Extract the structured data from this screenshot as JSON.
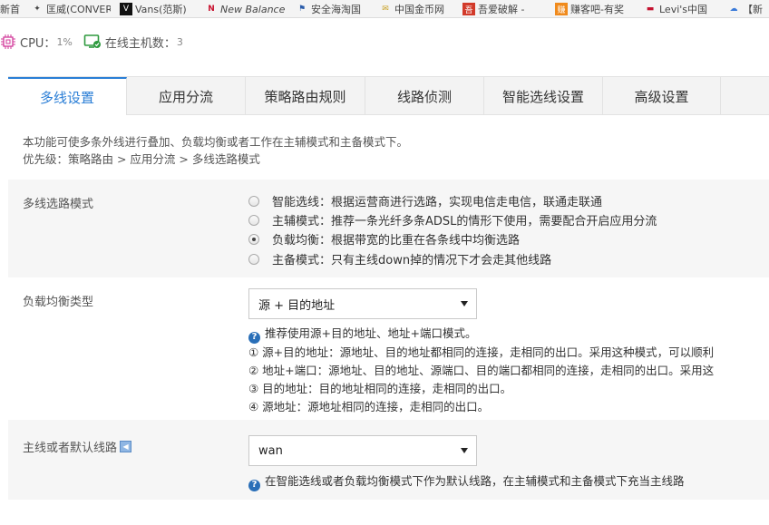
{
  "bookmarks": [
    {
      "label": "新首",
      "icon": "blank-icon",
      "color": "#888888"
    },
    {
      "label": "匡威(CONVER",
      "icon": "converse-star-icon",
      "color": "#333333"
    },
    {
      "label": "Vans(范斯)",
      "icon": "vans-v-icon",
      "color": "#111111"
    },
    {
      "label": "New Balance",
      "icon": "nb-logo-icon",
      "color": "#c8102e"
    },
    {
      "label": "安全海淘国",
      "icon": "flag-icon",
      "color": "#2a5caa"
    },
    {
      "label": "中国金币网",
      "icon": "envelope-icon",
      "color": "#c9a227"
    },
    {
      "label": "吾爱破解 -",
      "icon": "52pojie-icon",
      "color": "#d23a2a"
    },
    {
      "label": "赚客吧-有奖",
      "icon": "zhuanke-icon",
      "color": "#f08a1c"
    },
    {
      "label": "Levi's中国",
      "icon": "levis-icon",
      "color": "#c41230"
    },
    {
      "label": "【新",
      "icon": "cloud-icon",
      "color": "#3a7ad9"
    }
  ],
  "status": {
    "cpu_label": "CPU：",
    "cpu_value": "1%",
    "hosts_label": "在线主机数：",
    "hosts_value": "3"
  },
  "tabs": [
    {
      "label": "多线设置",
      "active": true
    },
    {
      "label": "应用分流",
      "active": false
    },
    {
      "label": "策略路由规则",
      "active": false
    },
    {
      "label": "线路侦测",
      "active": false
    },
    {
      "label": "智能选线设置",
      "active": false
    },
    {
      "label": "高级设置",
      "active": false
    }
  ],
  "intro": {
    "line1": "本功能可使多条外线进行叠加、负载均衡或者工作在主辅模式和主备模式下。",
    "line2": "优先级：策略路由 > 应用分流 > 多线选路模式"
  },
  "mode_section": {
    "label": "多线选路模式",
    "options": [
      {
        "text": "智能选线：根据运营商进行选路，实现电信走电信，联通走联通",
        "checked": false
      },
      {
        "text": "主辅模式：推荐一条光纤多条ADSL的情形下使用，需要配合开启应用分流",
        "checked": false
      },
      {
        "text": "负载均衡：根据带宽的比重在各条线中均衡选路",
        "checked": true
      },
      {
        "text": "主备模式：只有主线down掉的情况下才会走其他线路",
        "checked": false
      }
    ]
  },
  "lb_section": {
    "label": "负载均衡类型",
    "selected": "源 + 目的地址",
    "help_title": "推荐使用源+目的地址、地址+端口模式。",
    "help_lines": [
      "① 源+目的地址：源地址、目的地址都相同的连接，走相同的出口。采用这种模式，可以顺利",
      "② 地址+端口：源地址、目的地址、源端口、目的端口都相同的连接，走相同的出口。采用这",
      "③ 目的地址：目的地址相同的连接，走相同的出口。",
      "④ 源地址：源地址相同的连接，走相同的出口。"
    ]
  },
  "default_section": {
    "label": "主线或者默认线路",
    "selected": "wan",
    "help": "在智能选线或者负载均衡模式下作为默认线路，在主辅模式和主备模式下充当主线路"
  },
  "colors": {
    "accent": "#2a7ed6",
    "help_icon": "#2a6fb8",
    "row_gray": "#f6f6f6"
  }
}
